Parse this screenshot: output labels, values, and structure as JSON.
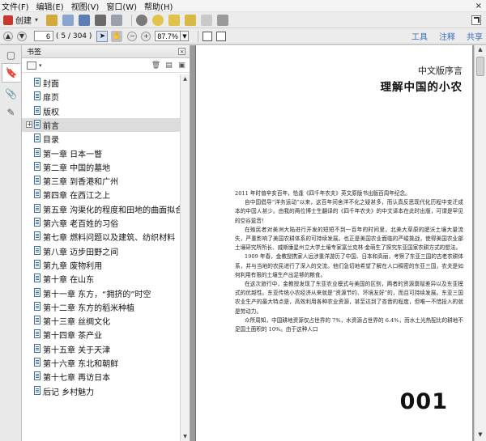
{
  "menu": [
    "文件(F)",
    "编辑(E)",
    "视图(V)",
    "窗口(W)",
    "帮助(H)"
  ],
  "menu_close": "×",
  "toolbar": {
    "create_label": "创建",
    "caret": "▾"
  },
  "nav": {
    "page_value": "6",
    "page_count": "( 5 / 304 )",
    "zoom_value": "87.7%",
    "links": [
      "工具",
      "注释",
      "共享"
    ]
  },
  "panel": {
    "title": "书签",
    "close": "×",
    "bookmarks": [
      {
        "label": "封面"
      },
      {
        "label": "扉页"
      },
      {
        "label": "版权"
      },
      {
        "label": "前言",
        "selected": true,
        "expandable": true
      },
      {
        "label": "目录"
      },
      {
        "label": "第一章 日本一瞥"
      },
      {
        "label": "第二章 中国的墓地"
      },
      {
        "label": "第三章 到香港和广州"
      },
      {
        "label": "第四章 在西江之上"
      },
      {
        "label": "第五章 沟渠化的程度和田地的曲面拟合"
      },
      {
        "label": "第六章 老百姓的习俗"
      },
      {
        "label": "第七章 燃料问题以及建筑、纺织材料"
      },
      {
        "label": "第八章 迈步田野之间"
      },
      {
        "label": "第九章 废物利用"
      },
      {
        "label": "第十章 在山东"
      },
      {
        "label": "第十一章 东方，“拥挤的”时空"
      },
      {
        "label": "第十二章 东方的稻米种植"
      },
      {
        "label": "第十三章 丝绸文化"
      },
      {
        "label": "第十四章 茶产业"
      },
      {
        "label": "第十五章 关于天津"
      },
      {
        "label": "第十六章 东北和朝鲜"
      },
      {
        "label": "第十七章 再访日本"
      },
      {
        "label": "后记 乡村魅力"
      }
    ]
  },
  "document": {
    "preface_small": "中文版序言",
    "preface_title": "理解中国的小农",
    "paragraphs": [
      "2011 年时值辛亥百年，恰逢《四千年农夫》英文原版书出版百周年纪念。",
      "自中国倡导“洋务运动”以来，这百年间舍洋不化之疑甚多，而认真反思现代化历程中变迁成本的中国人甚少。由我的两位博士生翻译的《四千年农夫》的中文译本在此时出版，可谓是罕见的空谷跫音！",
      "在殖民者对美洲大陆进行开发的短短不到一百年的时间里，北美大草原的肥沃土壤大量流失，严重影响了美国农耕体系的可持续发展。也正是美国农业面临的严峻挑战，使得美国农业部土壤研究所所长、威斯康星州立大学土壤专家富兰克林·金萌生了探究东亚国家农耕方式的想法。",
      "1909 年春，金教授携家人远涉重洋游历了中国、日本和高丽，考察了东亚三国的古老农耕体系，并与当地的农民进行了深入的交流。他们急切地希望了解在人口稠密的东亚三国，农夫是如何利用有限的土壤生产出足够的粮食。",
      "在这次旅行中，金教授发现了东亚农业模式与美国的区别，两者的资源禀赋差异以及东亚模式的优越性。东亚传统小农经济从来就是“资源节约、环境友好”的，而且可持续发展。东亚三国农业生产的最大特点是，高效利用各种农业资源，甚至达到了吝啬的程度，但唯一不惜投入的就是劳动力。",
      "众所周知，中国耕地资源仅占世界的 7%，水资源占世界的 6.4%，而水土光热配比的耕地不足国土面积的 10%。由于这种人口"
    ],
    "page_number": "001"
  }
}
